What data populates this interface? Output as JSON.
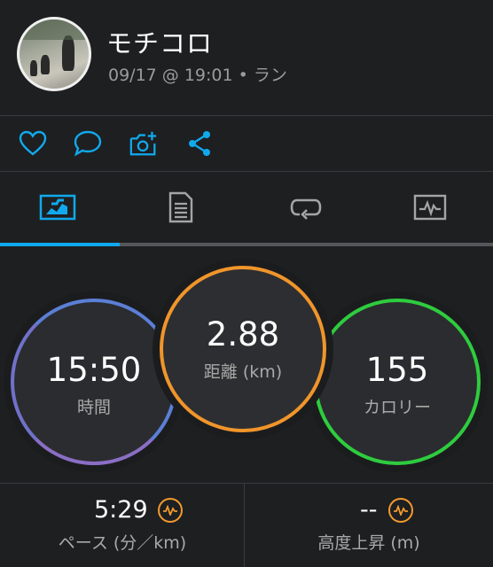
{
  "header": {
    "name": "モチコロ",
    "subtitle": "09/17 @ 19:01 • ラン"
  },
  "actions": [
    {
      "icon": "heart-icon"
    },
    {
      "icon": "comment-icon"
    },
    {
      "icon": "add-photo-icon"
    },
    {
      "icon": "share-icon"
    }
  ],
  "tabs": [
    {
      "icon": "summary-chart-icon",
      "active": true
    },
    {
      "icon": "details-document-icon",
      "active": false
    },
    {
      "icon": "laps-icon",
      "active": false
    },
    {
      "icon": "graph-icon",
      "active": false
    }
  ],
  "stats": {
    "time": {
      "value": "15:50",
      "label": "時間",
      "ring_color": "#5b7fd6"
    },
    "distance": {
      "value": "2.88",
      "label": "距離 (km)",
      "ring_color": "#f0952b"
    },
    "calories": {
      "value": "155",
      "label": "カロリー",
      "ring_color": "#2ecc3e"
    }
  },
  "bottom": {
    "pace": {
      "value": "5:29",
      "label": "ペース (分／km)"
    },
    "elevation": {
      "value": "--",
      "label": "高度上昇 (m)"
    }
  },
  "colors": {
    "accent": "#11a9ed",
    "background": "#1e1f21",
    "pulse": "#f29a2e"
  }
}
